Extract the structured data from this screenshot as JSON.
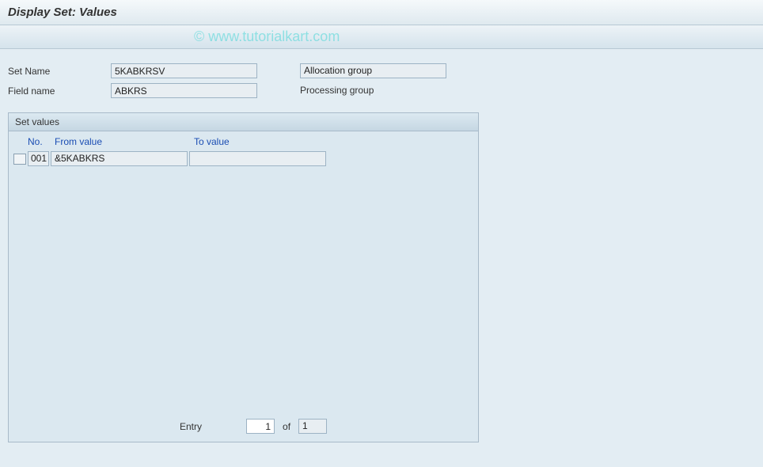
{
  "title": "Display Set: Values",
  "watermark": "© www.tutorialkart.com",
  "fields": {
    "set_name_label": "Set Name",
    "set_name_value": "5KABKRSV",
    "set_name_desc": "Allocation group",
    "field_name_label": "Field name",
    "field_name_value": "ABKRS",
    "field_name_desc": "Processing group"
  },
  "panel": {
    "title": "Set values",
    "columns": {
      "no": "No.",
      "from": "From value",
      "to": "To value"
    },
    "rows": [
      {
        "no": "001",
        "from": "&5KABKRS",
        "to": ""
      }
    ],
    "footer": {
      "entry_label": "Entry",
      "entry_value": "1",
      "of_label": "of",
      "total": "1"
    }
  }
}
